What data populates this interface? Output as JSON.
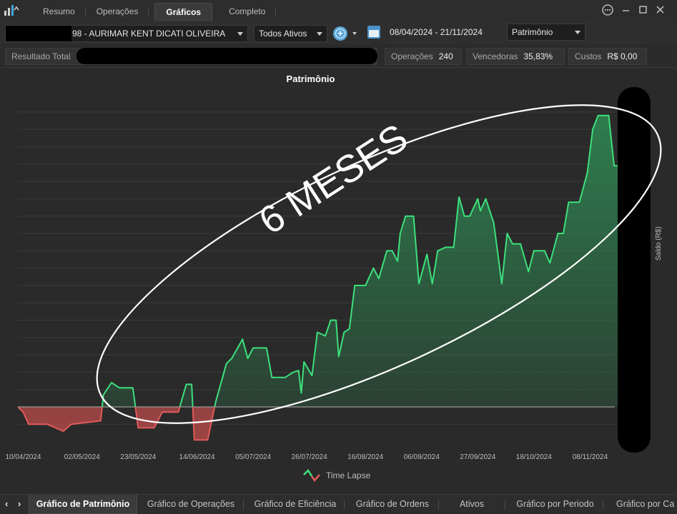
{
  "window": {
    "tabs": [
      "Resumo",
      "Operações",
      "Gráficos",
      "Completo"
    ],
    "active_tab": "Gráficos",
    "icons": [
      "chart-logo-icon",
      "chevron-up-icon",
      "more-options-icon",
      "minimize-icon",
      "maximize-icon",
      "close-icon"
    ]
  },
  "toolbar": {
    "account": "98 - AURIMAR KENT DICATI OLIVEIRA",
    "asset_filter": "Todos Ativos",
    "date_range": "08/04/2024 - 21/11/2024",
    "chart_mode": "Patrimônio"
  },
  "stats": {
    "resultado_label": "Resultado Total",
    "operacoes_label": "Operações",
    "operacoes_value": "240",
    "vencedoras_label": "Vencedoras",
    "vencedoras_value": "35,83%",
    "custos_label": "Custos",
    "custos_value": "R$ 0,00"
  },
  "chart": {
    "title": "Patrimônio",
    "ylabel": "Saldo (R$)",
    "legend": "Time Lapse",
    "annotation": "6 MESES",
    "colors": {
      "up": "#3de07c",
      "down": "#e05a5a",
      "fill_up": "#2f8f55",
      "fill_down": "#b04848"
    }
  },
  "chart_data": {
    "type": "area",
    "title": "Patrimônio",
    "ylabel": "Saldo (R$)",
    "legend": [
      "Time Lapse"
    ],
    "x_ticks": [
      "10/04/2024",
      "02/05/2024",
      "23/05/2024",
      "14/06/2024",
      "05/07/2024",
      "26/07/2024",
      "16/08/2024",
      "06/09/2024",
      "27/09/2024",
      "18/10/2024",
      "08/11/2024"
    ],
    "grid": true,
    "baseline": 0,
    "x_start": "2024-04-08",
    "x_end": "2024-11-21",
    "points": [
      [
        "2024-04-08",
        0.0
      ],
      [
        "2024-04-10",
        -0.3
      ],
      [
        "2024-04-12",
        -1.0
      ],
      [
        "2024-04-19",
        -1.0
      ],
      [
        "2024-04-25",
        -1.4
      ],
      [
        "2024-04-28",
        -1.0
      ],
      [
        "2024-05-09",
        -0.8
      ],
      [
        "2024-05-10",
        0.7
      ],
      [
        "2024-05-13",
        1.4
      ],
      [
        "2024-05-16",
        1.1
      ],
      [
        "2024-05-21",
        1.1
      ],
      [
        "2024-05-23",
        -1.2
      ],
      [
        "2024-05-29",
        -1.2
      ],
      [
        "2024-06-01",
        -0.3
      ],
      [
        "2024-06-07",
        -0.3
      ],
      [
        "2024-06-10",
        1.3
      ],
      [
        "2024-06-12",
        1.3
      ],
      [
        "2024-06-13",
        -1.9
      ],
      [
        "2024-06-18",
        -1.9
      ],
      [
        "2024-06-21",
        0.3
      ],
      [
        "2024-06-25",
        2.5
      ],
      [
        "2024-06-27",
        2.8
      ],
      [
        "2024-07-01",
        3.9
      ],
      [
        "2024-07-03",
        2.8
      ],
      [
        "2024-07-05",
        3.4
      ],
      [
        "2024-07-10",
        3.4
      ],
      [
        "2024-07-12",
        1.7
      ],
      [
        "2024-07-17",
        1.7
      ],
      [
        "2024-07-20",
        2.0
      ],
      [
        "2024-07-22",
        2.1
      ],
      [
        "2024-07-23",
        0.8
      ],
      [
        "2024-07-24",
        2.6
      ],
      [
        "2024-07-27",
        1.8
      ],
      [
        "2024-07-29",
        4.3
      ],
      [
        "2024-08-01",
        4.1
      ],
      [
        "2024-08-03",
        5.0
      ],
      [
        "2024-08-05",
        5.0
      ],
      [
        "2024-08-06",
        2.9
      ],
      [
        "2024-08-08",
        4.3
      ],
      [
        "2024-08-10",
        4.5
      ],
      [
        "2024-08-12",
        7.0
      ],
      [
        "2024-08-16",
        7.0
      ],
      [
        "2024-08-19",
        8.0
      ],
      [
        "2024-08-21",
        7.4
      ],
      [
        "2024-08-24",
        9.0
      ],
      [
        "2024-08-26",
        9.0
      ],
      [
        "2024-08-28",
        8.4
      ],
      [
        "2024-08-29",
        10.0
      ],
      [
        "2024-08-31",
        11.0
      ],
      [
        "2024-09-03",
        11.0
      ],
      [
        "2024-09-05",
        7.1
      ],
      [
        "2024-09-08",
        8.8
      ],
      [
        "2024-09-10",
        7.1
      ],
      [
        "2024-09-12",
        9.0
      ],
      [
        "2024-09-15",
        9.2
      ],
      [
        "2024-09-18",
        9.2
      ],
      [
        "2024-09-20",
        12.1
      ],
      [
        "2024-09-22",
        11.0
      ],
      [
        "2024-09-24",
        11.0
      ],
      [
        "2024-09-27",
        12.0
      ],
      [
        "2024-09-28",
        11.3
      ],
      [
        "2024-09-30",
        12.0
      ],
      [
        "2024-10-03",
        10.6
      ],
      [
        "2024-10-06",
        7.1
      ],
      [
        "2024-10-08",
        10.0
      ],
      [
        "2024-10-10",
        9.4
      ],
      [
        "2024-10-13",
        9.4
      ],
      [
        "2024-10-16",
        7.8
      ],
      [
        "2024-10-18",
        9.0
      ],
      [
        "2024-10-22",
        9.0
      ],
      [
        "2024-10-24",
        8.3
      ],
      [
        "2024-10-27",
        10.0
      ],
      [
        "2024-10-29",
        10.0
      ],
      [
        "2024-10-31",
        11.8
      ],
      [
        "2024-11-04",
        11.8
      ],
      [
        "2024-11-07",
        13.5
      ],
      [
        "2024-11-09",
        16.0
      ],
      [
        "2024-11-11",
        16.8
      ],
      [
        "2024-11-15",
        16.8
      ],
      [
        "2024-11-17",
        13.9
      ],
      [
        "2024-11-19",
        13.9
      ],
      [
        "2024-11-21",
        17.6
      ]
    ]
  },
  "bottom_tabs": [
    "Gráfico de Patrimônio",
    "Gráfico de Operações",
    "Gráfico de Eficiência",
    "Gráfico de Ordens",
    "Ativos",
    "Gráfico por Periodo",
    "Gráfico por Ca"
  ],
  "active_bottom_tab": "Gráfico de Patrimônio"
}
